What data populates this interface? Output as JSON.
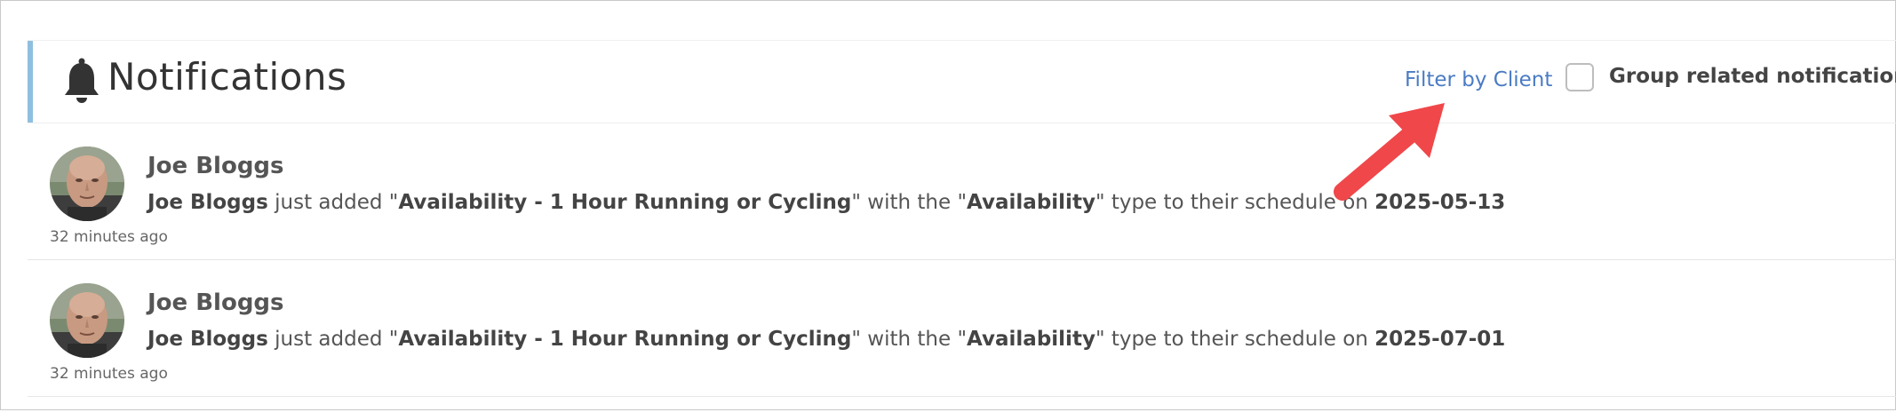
{
  "header": {
    "title": "Notifications",
    "icon": "bell-icon",
    "filter_link": "Filter by Client",
    "group_checkbox_label": "Group related notifications",
    "group_checkbox_checked": false
  },
  "colors": {
    "accent_bar": "#8fbfe0",
    "link": "#4a7bc4",
    "arrow": "#f0474a"
  },
  "notifications": [
    {
      "name": "Joe Bloggs",
      "actor": "Joe Bloggs",
      "t1": " just added \"",
      "event": "Availability - 1 Hour Running or Cycling",
      "t2": "\" with the \"",
      "type": "Availability",
      "t3": "\" type to their schedule on ",
      "date": "2025-05-13",
      "time_ago": "32 minutes ago"
    },
    {
      "name": "Joe Bloggs",
      "actor": "Joe Bloggs",
      "t1": " just added \"",
      "event": "Availability - 1 Hour Running or Cycling",
      "t2": "\" with the \"",
      "type": "Availability",
      "t3": "\" type to their schedule on ",
      "date": "2025-07-01",
      "time_ago": "32 minutes ago"
    }
  ]
}
